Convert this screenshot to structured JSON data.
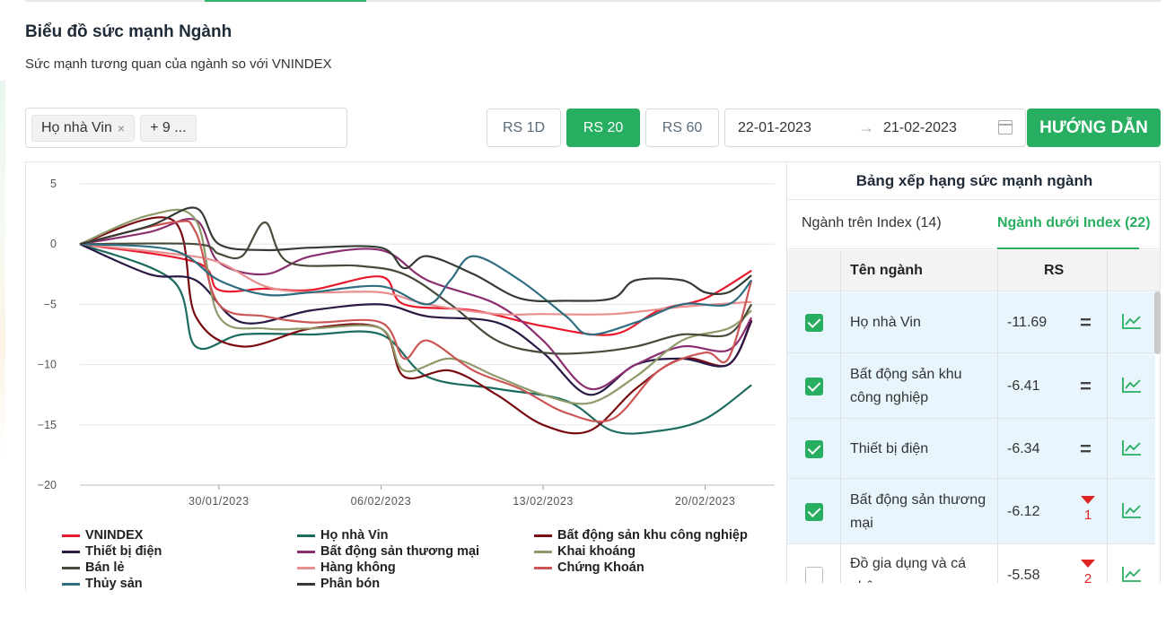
{
  "header": {
    "title": "Biểu đồ sức mạnh Ngành",
    "subtitle": "Sức mạnh tương quan của ngành so với VNINDEX"
  },
  "filters": {
    "tag_selected": "Họ nhà Vin",
    "tag_remove": "×",
    "tag_more": "+ 9 ...",
    "rs_buttons": [
      {
        "label": "RS 1D",
        "active": false
      },
      {
        "label": "RS 20",
        "active": true
      },
      {
        "label": "RS 60",
        "active": false
      }
    ],
    "date_start": "22-01-2023",
    "date_arrow": "→",
    "date_end": "21-02-2023",
    "guide_label": "HƯỚNG DẪN"
  },
  "colors": {
    "accent": "#27ae60",
    "selected_row": "#e8f5fc",
    "trend_down": "#e02424"
  },
  "chart_data": {
    "type": "line",
    "ylim": [
      -20,
      5
    ],
    "yticks": [
      "5",
      "0",
      "−5",
      "−10",
      "−15",
      "−20"
    ],
    "ytick_values": [
      5,
      0,
      -5,
      -10,
      -15,
      -20
    ],
    "xlim": [
      0,
      30
    ],
    "xticks": [
      "30/01/2023",
      "06/02/2023",
      "13/02/2023",
      "20/02/2023"
    ],
    "xtick_values": [
      6,
      13,
      20,
      27
    ],
    "grid": true,
    "legend_placement": "bottom",
    "series": [
      {
        "name": "VNINDEX",
        "color": "#e8192c",
        "values": [
          [
            0,
            0
          ],
          [
            5,
            -1.5
          ],
          [
            6,
            -3.8
          ],
          [
            8,
            -3.7
          ],
          [
            10,
            -3.8
          ],
          [
            13,
            -2.7
          ],
          [
            14,
            -5
          ],
          [
            17,
            -5.5
          ],
          [
            20,
            -6.8
          ],
          [
            23,
            -7.5
          ],
          [
            25,
            -5.5
          ],
          [
            27,
            -4.5
          ],
          [
            29,
            -2.2
          ]
        ]
      },
      {
        "name": "Họ nhà Vin",
        "color": "#1c6b5f",
        "values": [
          [
            0,
            0
          ],
          [
            4,
            -3
          ],
          [
            5,
            -8.5
          ],
          [
            7,
            -7.5
          ],
          [
            10,
            -7.5
          ],
          [
            13,
            -7.5
          ],
          [
            15,
            -11
          ],
          [
            18,
            -12
          ],
          [
            21,
            -13
          ],
          [
            23,
            -15.5
          ],
          [
            25,
            -15.5
          ],
          [
            27,
            -14.5
          ],
          [
            29,
            -11.7
          ]
        ]
      },
      {
        "name": "Bất động sản khu công nghiệp",
        "color": "#7a0a12",
        "values": [
          [
            0,
            0
          ],
          [
            4,
            2
          ],
          [
            5,
            -6
          ],
          [
            7,
            -8.5
          ],
          [
            10,
            -7
          ],
          [
            13,
            -7
          ],
          [
            14,
            -11
          ],
          [
            16,
            -10.5
          ],
          [
            18,
            -12.5
          ],
          [
            20,
            -15
          ],
          [
            22,
            -15.5
          ],
          [
            24,
            -12
          ],
          [
            26,
            -9.5
          ],
          [
            28,
            -10
          ],
          [
            29,
            -6.4
          ]
        ]
      },
      {
        "name": "Thiết bị điện",
        "color": "#2a1845",
        "values": [
          [
            0,
            0
          ],
          [
            3,
            -2.5
          ],
          [
            5,
            -3
          ],
          [
            7,
            -6.5
          ],
          [
            10,
            -5.5
          ],
          [
            13,
            -5
          ],
          [
            15,
            -6
          ],
          [
            18,
            -6.5
          ],
          [
            20,
            -9
          ],
          [
            22,
            -12.5
          ],
          [
            24,
            -10
          ],
          [
            26,
            -9.5
          ],
          [
            28,
            -10
          ],
          [
            29,
            -6.3
          ]
        ]
      },
      {
        "name": "Bất động sản thương mại",
        "color": "#8b2e70",
        "values": [
          [
            0,
            0
          ],
          [
            3,
            1
          ],
          [
            5,
            2
          ],
          [
            6,
            -1.5
          ],
          [
            8,
            -2.5
          ],
          [
            10,
            -1
          ],
          [
            13,
            -0.5
          ],
          [
            15,
            -3
          ],
          [
            18,
            -5
          ],
          [
            20,
            -8
          ],
          [
            22,
            -12
          ],
          [
            24,
            -10
          ],
          [
            26,
            -8.5
          ],
          [
            28,
            -8.8
          ],
          [
            29,
            -6.1
          ]
        ]
      },
      {
        "name": "Khai khoáng",
        "color": "#8e9a6a",
        "values": [
          [
            0,
            0
          ],
          [
            3,
            2.4
          ],
          [
            5,
            2
          ],
          [
            6,
            -6
          ],
          [
            8,
            -7
          ],
          [
            10,
            -7
          ],
          [
            13,
            -7
          ],
          [
            14,
            -10.5
          ],
          [
            16,
            -9.5
          ],
          [
            18,
            -11
          ],
          [
            20,
            -12.5
          ],
          [
            22,
            -13.2
          ],
          [
            24,
            -11
          ],
          [
            26,
            -8
          ],
          [
            28,
            -7
          ],
          [
            29,
            -5.5
          ]
        ]
      },
      {
        "name": "Bán lẻ",
        "color": "#4a4a3a",
        "values": [
          [
            0,
            0
          ],
          [
            5,
            0
          ],
          [
            6,
            -0.8
          ],
          [
            7,
            -1
          ],
          [
            8,
            1.8
          ],
          [
            9,
            -1.5
          ],
          [
            12,
            -1.8
          ],
          [
            14,
            -2.5
          ],
          [
            16,
            -5
          ],
          [
            18,
            -8
          ],
          [
            20,
            -9
          ],
          [
            22,
            -9
          ],
          [
            24,
            -8.5
          ],
          [
            26,
            -7.5
          ],
          [
            28,
            -7.5
          ],
          [
            29,
            -5
          ]
        ]
      },
      {
        "name": "Hàng không",
        "color": "#e89090",
        "values": [
          [
            0,
            0
          ],
          [
            4,
            -0.8
          ],
          [
            6,
            -1.5
          ],
          [
            8,
            -3.5
          ],
          [
            10,
            -4
          ],
          [
            13,
            -4
          ],
          [
            15,
            -5
          ],
          [
            18,
            -5.8
          ],
          [
            20,
            -5.8
          ],
          [
            23,
            -5.8
          ],
          [
            26,
            -5.2
          ],
          [
            29,
            -4.8
          ]
        ]
      },
      {
        "name": "Chứng Khoán",
        "color": "#cc5555",
        "values": [
          [
            0,
            0
          ],
          [
            4,
            1.8
          ],
          [
            5,
            1
          ],
          [
            6,
            -5
          ],
          [
            8,
            -6
          ],
          [
            10,
            -6.5
          ],
          [
            13,
            -6.5
          ],
          [
            14,
            -9.5
          ],
          [
            15,
            -8
          ],
          [
            17,
            -10.5
          ],
          [
            19,
            -12
          ],
          [
            21,
            -14
          ],
          [
            23,
            -14.5
          ],
          [
            25,
            -10.5
          ],
          [
            27,
            -9
          ],
          [
            28,
            -9.5
          ],
          [
            29,
            -3
          ]
        ]
      },
      {
        "name": "Thủy sản",
        "color": "#2f6e80",
        "values": [
          [
            0,
            0
          ],
          [
            4,
            -0.5
          ],
          [
            6,
            -3
          ],
          [
            8,
            -4.2
          ],
          [
            10,
            -4
          ],
          [
            13,
            -3.5
          ],
          [
            15,
            -5
          ],
          [
            16,
            -3
          ],
          [
            17,
            -1
          ],
          [
            19,
            -3
          ],
          [
            21,
            -6
          ],
          [
            22,
            -7.5
          ],
          [
            24,
            -6.5
          ],
          [
            26,
            -5
          ],
          [
            28,
            -5
          ],
          [
            29,
            -3
          ]
        ]
      },
      {
        "name": "Phân bón",
        "color": "#333b33",
        "values": [
          [
            0,
            0
          ],
          [
            3,
            1.5
          ],
          [
            5,
            3
          ],
          [
            6,
            0
          ],
          [
            8,
            -0.5
          ],
          [
            10,
            -0.3
          ],
          [
            13,
            -0.3
          ],
          [
            14,
            -2
          ],
          [
            15,
            -1
          ],
          [
            17,
            -2.5
          ],
          [
            19,
            -4.5
          ],
          [
            21,
            -4.7
          ],
          [
            23,
            -4.5
          ],
          [
            24,
            -3
          ],
          [
            26,
            -3
          ],
          [
            27,
            -4
          ],
          [
            28,
            -4
          ],
          [
            29,
            -2.6
          ]
        ]
      }
    ]
  },
  "ranking": {
    "title": "Bảng xếp hạng sức mạnh ngành",
    "tabs": [
      {
        "label": "Ngành trên Index (14)",
        "active": false
      },
      {
        "label": "Ngành dưới Index (22)",
        "active": true
      }
    ],
    "col_name": "Tên ngành",
    "col_rs": "RS",
    "rows": [
      {
        "name": "Họ nhà Vin",
        "rs": "-11.69",
        "checked": true,
        "trend": "=",
        "change": ""
      },
      {
        "name": "Bất động sản khu công nghiệp",
        "rs": "-6.41",
        "checked": true,
        "trend": "=",
        "change": ""
      },
      {
        "name": "Thiết bị điện",
        "rs": "-6.34",
        "checked": true,
        "trend": "=",
        "change": ""
      },
      {
        "name": "Bất động sản thương mại",
        "rs": "-6.12",
        "checked": true,
        "trend": "down",
        "change": "1"
      },
      {
        "name": "Đồ gia dụng và cá nhân",
        "rs": "-5.58",
        "checked": false,
        "trend": "down",
        "change": "2"
      }
    ]
  }
}
